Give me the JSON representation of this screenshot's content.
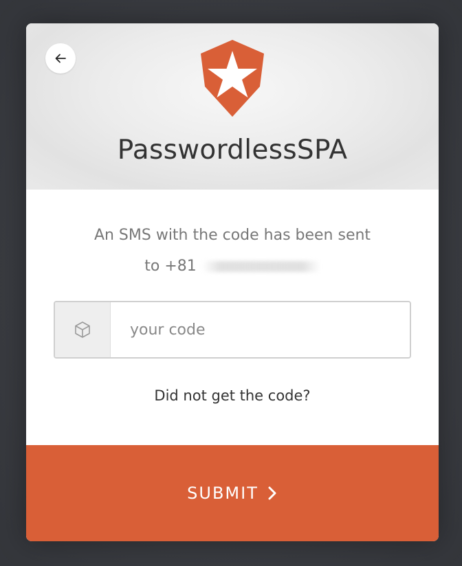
{
  "app": {
    "title": "PasswordlessSPA"
  },
  "header": {
    "back_icon": "arrow-left-icon",
    "logo_icon": "shield-star-logo"
  },
  "message": {
    "line1": "An SMS with the code has been sent",
    "phone_prefix": "to +81"
  },
  "code_input": {
    "placeholder": "your code",
    "value": "",
    "icon": "cube-icon"
  },
  "resend": {
    "label": "Did not get the code?"
  },
  "submit": {
    "label": "SUBMIT",
    "icon": "chevron-right-icon"
  },
  "colors": {
    "accent": "#d95f37",
    "background": "#3d3f44",
    "header_bg": "#ececec"
  }
}
